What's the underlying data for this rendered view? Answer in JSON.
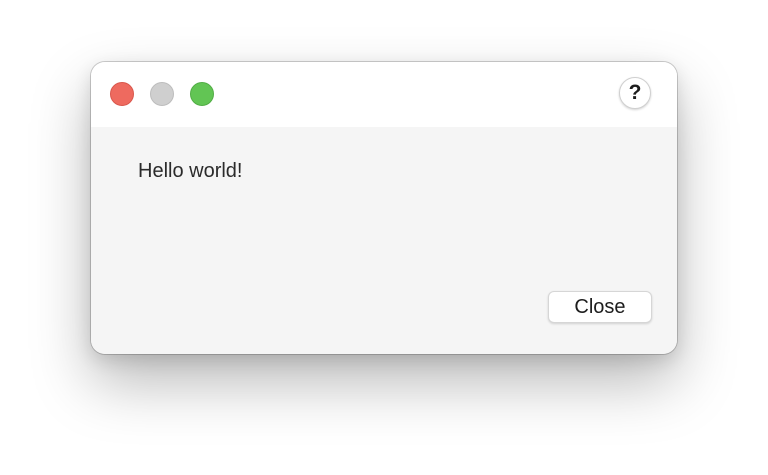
{
  "window": {
    "traffic_lights": {
      "close": {
        "icon": "close-circle-icon",
        "color": "#ee6a5f"
      },
      "minimize": {
        "icon": "minimize-circle-icon",
        "color": "#cfcfcf"
      },
      "zoom": {
        "icon": "zoom-circle-icon",
        "color": "#62c554"
      }
    },
    "help": {
      "icon": "question-mark-icon",
      "label": "?"
    }
  },
  "dialog": {
    "message": "Hello world!",
    "close_label": "Close"
  }
}
